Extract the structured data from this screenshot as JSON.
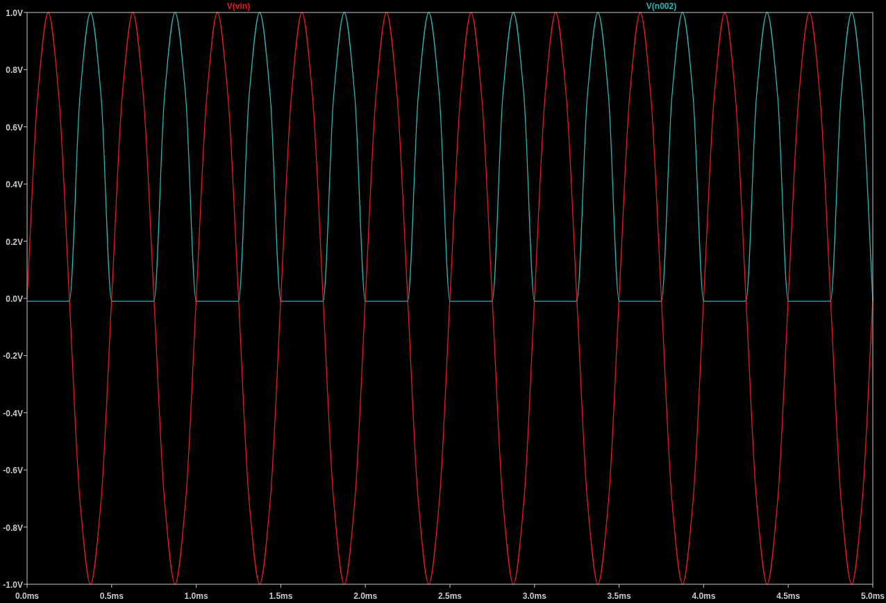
{
  "plot": {
    "chart_data": {
      "type": "line",
      "xlim": [
        0,
        5
      ],
      "ylim": [
        -1,
        1
      ],
      "xticks": [
        {
          "value": 0,
          "label": "0.0ms"
        },
        {
          "value": 0.5,
          "label": "0.5ms"
        },
        {
          "value": 1,
          "label": "1.0ms"
        },
        {
          "value": 1.5,
          "label": "1.5ms"
        },
        {
          "value": 2,
          "label": "2.0ms"
        },
        {
          "value": 2.5,
          "label": "2.5ms"
        },
        {
          "value": 3,
          "label": "3.0ms"
        },
        {
          "value": 3.5,
          "label": "3.5ms"
        },
        {
          "value": 4,
          "label": "4.0ms"
        },
        {
          "value": 4.5,
          "label": "4.5ms"
        },
        {
          "value": 5,
          "label": "5.0ms"
        }
      ],
      "yticks": [
        {
          "value": 1,
          "label": "1.0V"
        },
        {
          "value": 0.8,
          "label": "0.8V"
        },
        {
          "value": 0.6,
          "label": "0.6V"
        },
        {
          "value": 0.4,
          "label": "0.4V"
        },
        {
          "value": 0.2,
          "label": "0.2V"
        },
        {
          "value": 0,
          "label": "0.0V"
        },
        {
          "value": -0.2,
          "label": "-0.2V"
        },
        {
          "value": -0.4,
          "label": "-0.4V"
        },
        {
          "value": -0.6,
          "label": "-0.6V"
        },
        {
          "value": -0.8,
          "label": "-0.8V"
        },
        {
          "value": -1,
          "label": "-1.0V"
        }
      ],
      "x": [
        0,
        0.0625,
        0.125,
        0.1875,
        0.25,
        0.3125,
        0.375,
        0.4375,
        0.5,
        0.5625,
        0.625,
        0.6875,
        0.75,
        0.8125,
        0.875,
        0.9375,
        1,
        1.0625,
        1.125,
        1.1875,
        1.25,
        1.3125,
        1.375,
        1.4375,
        1.5,
        1.5625,
        1.625,
        1.6875,
        1.75,
        1.8125,
        1.875,
        1.9375,
        2,
        2.0625,
        2.125,
        2.1875,
        2.25,
        2.3125,
        2.375,
        2.4375,
        2.5,
        2.5625,
        2.625,
        2.6875,
        2.75,
        2.8125,
        2.875,
        2.9375,
        3,
        3.0625,
        3.125,
        3.1875,
        3.25,
        3.3125,
        3.375,
        3.4375,
        3.5,
        3.5625,
        3.625,
        3.6875,
        3.75,
        3.8125,
        3.875,
        3.9375,
        4,
        4.0625,
        4.125,
        4.1875,
        4.25,
        4.3125,
        4.375,
        4.4375,
        4.5,
        4.5625,
        4.625,
        4.6875,
        4.75,
        4.8125,
        4.875,
        4.9375,
        5
      ],
      "series": [
        {
          "name": "V(vin)",
          "color": "#e81c1c",
          "values": [
            0,
            0.707,
            1,
            0.707,
            0,
            -0.707,
            -1,
            -0.707,
            0,
            0.707,
            1,
            0.707,
            0,
            -0.707,
            -1,
            -0.707,
            0,
            0.707,
            1,
            0.707,
            0,
            -0.707,
            -1,
            -0.707,
            0,
            0.707,
            1,
            0.707,
            0,
            -0.707,
            -1,
            -0.707,
            0,
            0.707,
            1,
            0.707,
            0,
            -0.707,
            -1,
            -0.707,
            0,
            0.707,
            1,
            0.707,
            0,
            -0.707,
            -1,
            -0.707,
            0,
            0.707,
            1,
            0.707,
            0,
            -0.707,
            -1,
            -0.707,
            0,
            0.707,
            1,
            0.707,
            0,
            -0.707,
            -1,
            -0.707,
            0,
            0.707,
            1,
            0.707,
            0,
            -0.707,
            -1,
            -0.707,
            0,
            0.707,
            1,
            0.707,
            0,
            -0.707,
            -1,
            -0.707,
            0
          ]
        },
        {
          "name": "V(n002)",
          "color": "#2ab4b4",
          "values": [
            -0.01,
            -0.01,
            -0.01,
            -0.01,
            -0.01,
            0.707,
            1,
            0.707,
            -0.01,
            -0.01,
            -0.01,
            -0.01,
            -0.01,
            0.707,
            1,
            0.707,
            -0.01,
            -0.01,
            -0.01,
            -0.01,
            -0.01,
            0.707,
            1,
            0.707,
            -0.01,
            -0.01,
            -0.01,
            -0.01,
            -0.01,
            0.707,
            1,
            0.707,
            -0.01,
            -0.01,
            -0.01,
            -0.01,
            -0.01,
            0.707,
            1,
            0.707,
            -0.01,
            -0.01,
            -0.01,
            -0.01,
            -0.01,
            0.707,
            1,
            0.707,
            -0.01,
            -0.01,
            -0.01,
            -0.01,
            -0.01,
            0.707,
            1,
            0.707,
            -0.01,
            -0.01,
            -0.01,
            -0.01,
            -0.01,
            0.707,
            1,
            0.707,
            -0.01,
            -0.01,
            -0.01,
            -0.01,
            -0.01,
            0.707,
            1,
            0.707,
            -0.01,
            -0.01,
            -0.01,
            -0.01,
            -0.01,
            0.707,
            1,
            0.707,
            -0.01
          ]
        }
      ]
    }
  }
}
